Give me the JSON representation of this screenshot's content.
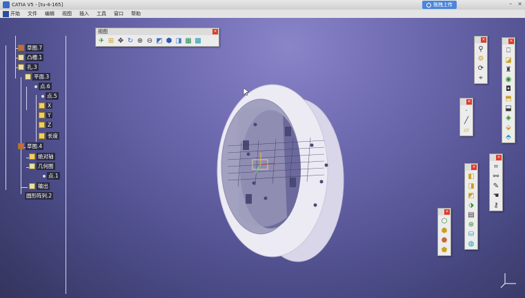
{
  "window": {
    "title": "CATIA V5 - [tu-4-165]",
    "upload_label": "拖拽上传",
    "icons": {
      "app": "catia-logo-icon",
      "upload": "cloud-upload-icon"
    }
  },
  "menu": {
    "items": [
      "开始",
      "文件",
      "编辑",
      "视图",
      "插入",
      "工具",
      "窗口",
      "帮助"
    ]
  },
  "tree": {
    "nodes": [
      {
        "label": "草图.7",
        "kind": "sketch"
      },
      {
        "label": "凸槽.1",
        "kind": "pocket"
      },
      {
        "label": "孔.3",
        "kind": "hole"
      },
      {
        "label": "平面.3",
        "kind": "plane"
      },
      {
        "label": "点.6",
        "kind": "point"
      },
      {
        "label": "点.5",
        "kind": "point"
      },
      {
        "label": "X",
        "kind": "param"
      },
      {
        "label": "Y",
        "kind": "param"
      },
      {
        "label": "Z",
        "kind": "param"
      },
      {
        "label": "长度",
        "kind": "param"
      },
      {
        "label": "草图.4",
        "kind": "sketch"
      },
      {
        "label": "绝对轴",
        "kind": "axis"
      },
      {
        "label": "几何图",
        "kind": "geometry"
      },
      {
        "label": "点.1",
        "kind": "point"
      },
      {
        "label": "输出",
        "kind": "output"
      },
      {
        "label": "圆形阵列.2",
        "kind": "pattern"
      }
    ]
  },
  "view_toolbar": {
    "title": "视图",
    "buttons": [
      "fly-mode-icon",
      "fit-all-icon",
      "pan-icon",
      "rotate-icon",
      "zoom-in-icon",
      "zoom-out-icon",
      "normal-view-icon",
      "iso-view-icon",
      "shading-icon",
      "hide-show-icon",
      "swap-space-icon"
    ]
  },
  "colors": {
    "accent": "#4d86d8",
    "close": "#e03a2a",
    "part": "#e6e4f2"
  }
}
